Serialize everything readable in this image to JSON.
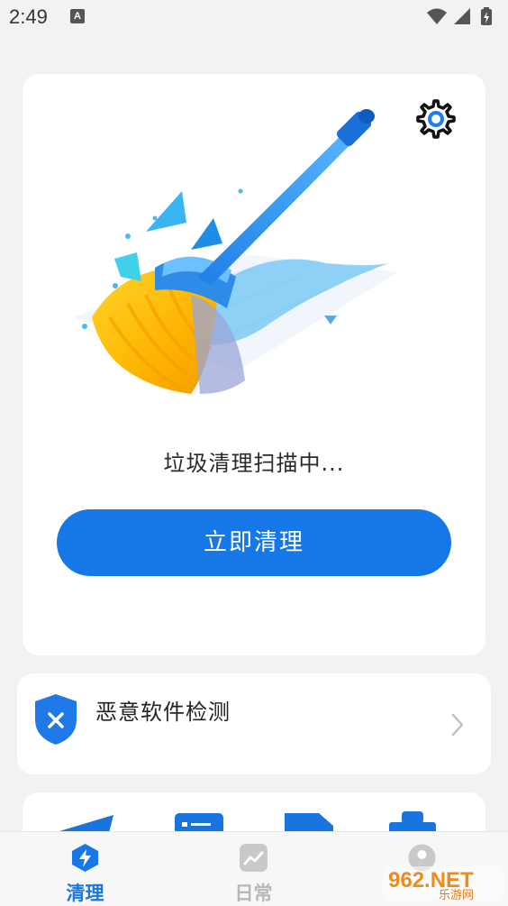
{
  "status": {
    "time": "2:49",
    "notif_glyph": "A",
    "wifi": "wifi-icon",
    "signal": "signal-icon",
    "battery": "battery-charging-icon"
  },
  "main": {
    "scan_status": "垃圾清理扫描中...",
    "clean_button": "立即清理",
    "settings_icon": "gear-icon",
    "hero_image": "broom-illustration"
  },
  "malware": {
    "label": "恶意软件检测",
    "icon": "shield-x-icon"
  },
  "tools": [
    "paper-plane-icon",
    "id-card-icon",
    "document-icon",
    "toolbox-icon"
  ],
  "nav": {
    "items": [
      {
        "label": "清理",
        "icon": "lightning-icon",
        "active": true
      },
      {
        "label": "日常",
        "icon": "trend-icon",
        "active": false
      },
      {
        "label": "",
        "icon": "profile-icon",
        "active": false
      }
    ],
    "active_color": "#1677e6",
    "inactive_color": "#b8b8b8"
  },
  "watermark": {
    "brand": "962.NET",
    "sub": "乐游网"
  },
  "colors": {
    "accent": "#1677e6",
    "background": "#f2f2f2"
  }
}
